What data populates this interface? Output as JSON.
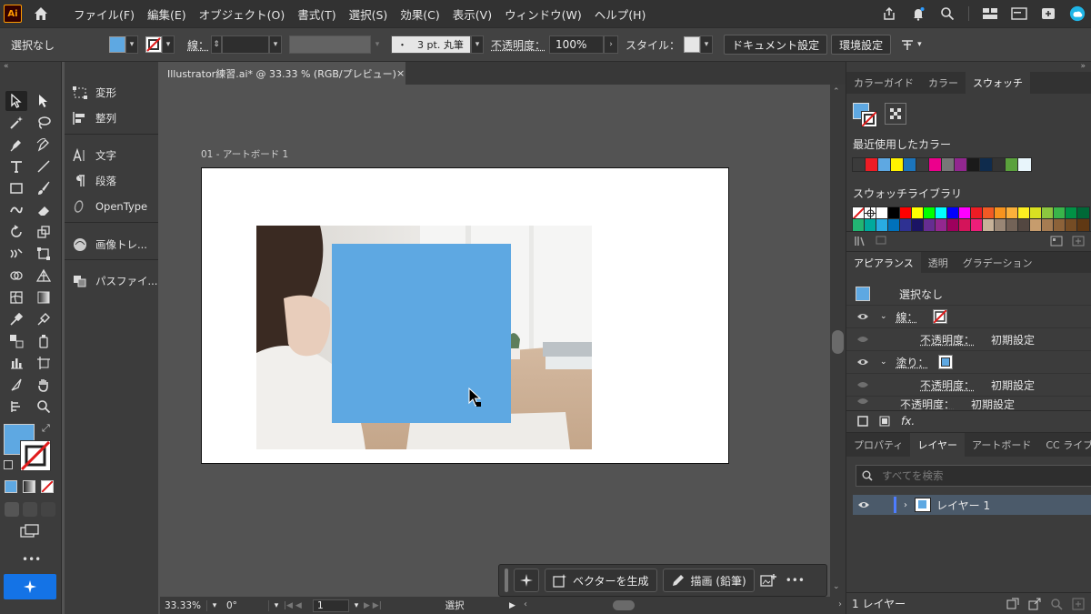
{
  "menubar": {
    "logo": "Ai",
    "menus": [
      "ファイル(F)",
      "編集(E)",
      "オブジェクト(O)",
      "書式(T)",
      "選択(S)",
      "効果(C)",
      "表示(V)",
      "ウィンドウ(W)",
      "ヘルプ(H)"
    ]
  },
  "controlbar": {
    "selection": "選択なし",
    "stroke_label": "線：",
    "brush_value": "・　3 pt. 丸筆",
    "opacity_label": "不透明度：",
    "opacity_value": "100%",
    "style_label": "スタイル：",
    "doc_settings": "ドキュメント設定",
    "preferences": "環境設定"
  },
  "document_tab": {
    "title": "Illustrator練習.ai* @ 33.33 % (RGB/プレビュー)",
    "close": "×"
  },
  "artboard": {
    "label": "01 - アートボード 1"
  },
  "side_panel": {
    "items": [
      "変形",
      "整列",
      "文字",
      "段落",
      "OpenType",
      "画像トレ...",
      "パスファイ..."
    ]
  },
  "toolbar": {
    "more": "•••"
  },
  "context_bar": {
    "generate_vector": "ベクターを生成",
    "draw_pencil": "描画 (鉛筆)",
    "more": "•••"
  },
  "statusbar": {
    "zoom": "33.33%",
    "rotation": "0°",
    "artboard_num": "1",
    "tool": "選択"
  },
  "swatches_panel": {
    "tabs": [
      "カラーガイド",
      "カラー",
      "スウォッチ"
    ],
    "active_tab": "スウォッチ",
    "recent_label": "最近使用したカラー",
    "library_label": "スウォッチライブラリ",
    "recent_colors": [
      "#3b3b3b",
      "#ee1c25",
      "#5ea8e2",
      "#fff200",
      "#1c75bc",
      "#3c3c3c",
      "#ec008c",
      "#777777",
      "#92278f",
      "#1a1a1a",
      "#0f2b4c",
      "#333333",
      "#5aa13c",
      "#e8f5fb"
    ],
    "library_row1": [
      "none",
      "reg",
      "#ffffff",
      "#000000",
      "#ff0000",
      "#ffff00",
      "#00ff00",
      "#00ffff",
      "#0000ff",
      "#ff00ff",
      "#ed1c24",
      "#f15a24",
      "#f7931e",
      "#fbb03b",
      "#fcee21",
      "#d9e021",
      "#8cc63f",
      "#39b54a",
      "#009245",
      "#006837"
    ],
    "library_row2": [
      "#22b573",
      "#00a99d",
      "#29abe2",
      "#0071bc",
      "#2e3192",
      "#1b1464",
      "#662d91",
      "#93278f",
      "#9e005d",
      "#d4145a",
      "#ed1e79",
      "#c7b299",
      "#998675",
      "#736357",
      "#534741",
      "#c69c6d",
      "#a67c52",
      "#8c6239",
      "#754c24",
      "#603813"
    ]
  },
  "appearance_panel": {
    "tabs": [
      "アピアランス",
      "透明",
      "グラデーション"
    ],
    "active_tab": "アピアランス",
    "title": "選択なし",
    "stroke": "線：",
    "stroke_opacity_label": "不透明度：",
    "stroke_opacity_value": "初期設定",
    "fill": "塗り：",
    "fill_opacity_label": "不透明度：",
    "fill_opacity_value": "初期設定",
    "opacity_label": "不透明度：",
    "opacity_value": "初期設定"
  },
  "layers_panel": {
    "tabs": [
      "プロパティ",
      "レイヤー",
      "アートボード",
      "CC ライブラリ"
    ],
    "active_tab": "レイヤー",
    "search_placeholder": "すべてを検索",
    "layer_name": "レイヤー 1",
    "count": "1 レイヤー"
  },
  "colors": {
    "fill": "#5ea8e2",
    "accent": "#1473e6"
  }
}
